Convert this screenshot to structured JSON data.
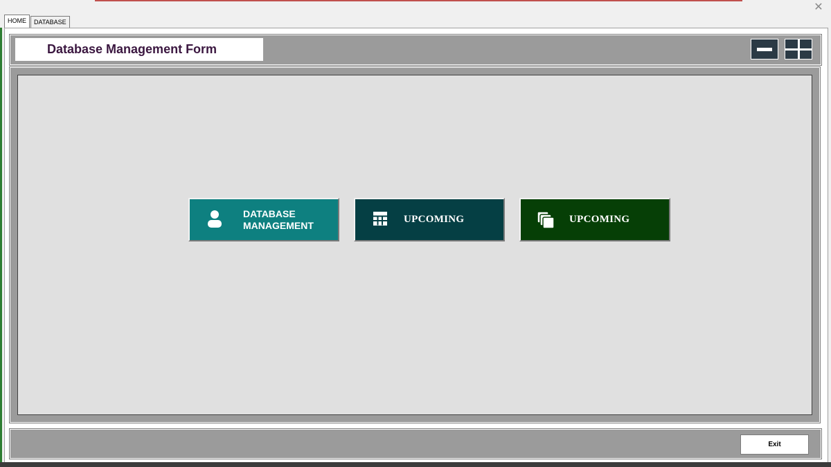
{
  "window": {
    "close_glyph": "✕"
  },
  "tabs": [
    {
      "label": "HOME",
      "active": true
    },
    {
      "label": "DATABASE",
      "active": false
    }
  ],
  "header": {
    "title": "Database Management Form",
    "minimize_icon": "minimize-icon",
    "maximize_icon": "maximize-icon"
  },
  "buttons": [
    {
      "label_line1": "DATABASE",
      "label_line2": "MANAGEMENT",
      "icon": "user-icon",
      "color": "#0e8080"
    },
    {
      "label": "UPCOMING",
      "icon": "grid-icon",
      "color": "#053f44"
    },
    {
      "label": "UPCOMING",
      "icon": "stack-icon",
      "color": "#063f06"
    }
  ],
  "footer": {
    "exit_label": "Exit"
  },
  "colors": {
    "frame_gray": "#9b9b9b",
    "panel_gray": "#e0e0e0",
    "title_text": "#3b1740",
    "window_btn": "#2b3a45"
  }
}
